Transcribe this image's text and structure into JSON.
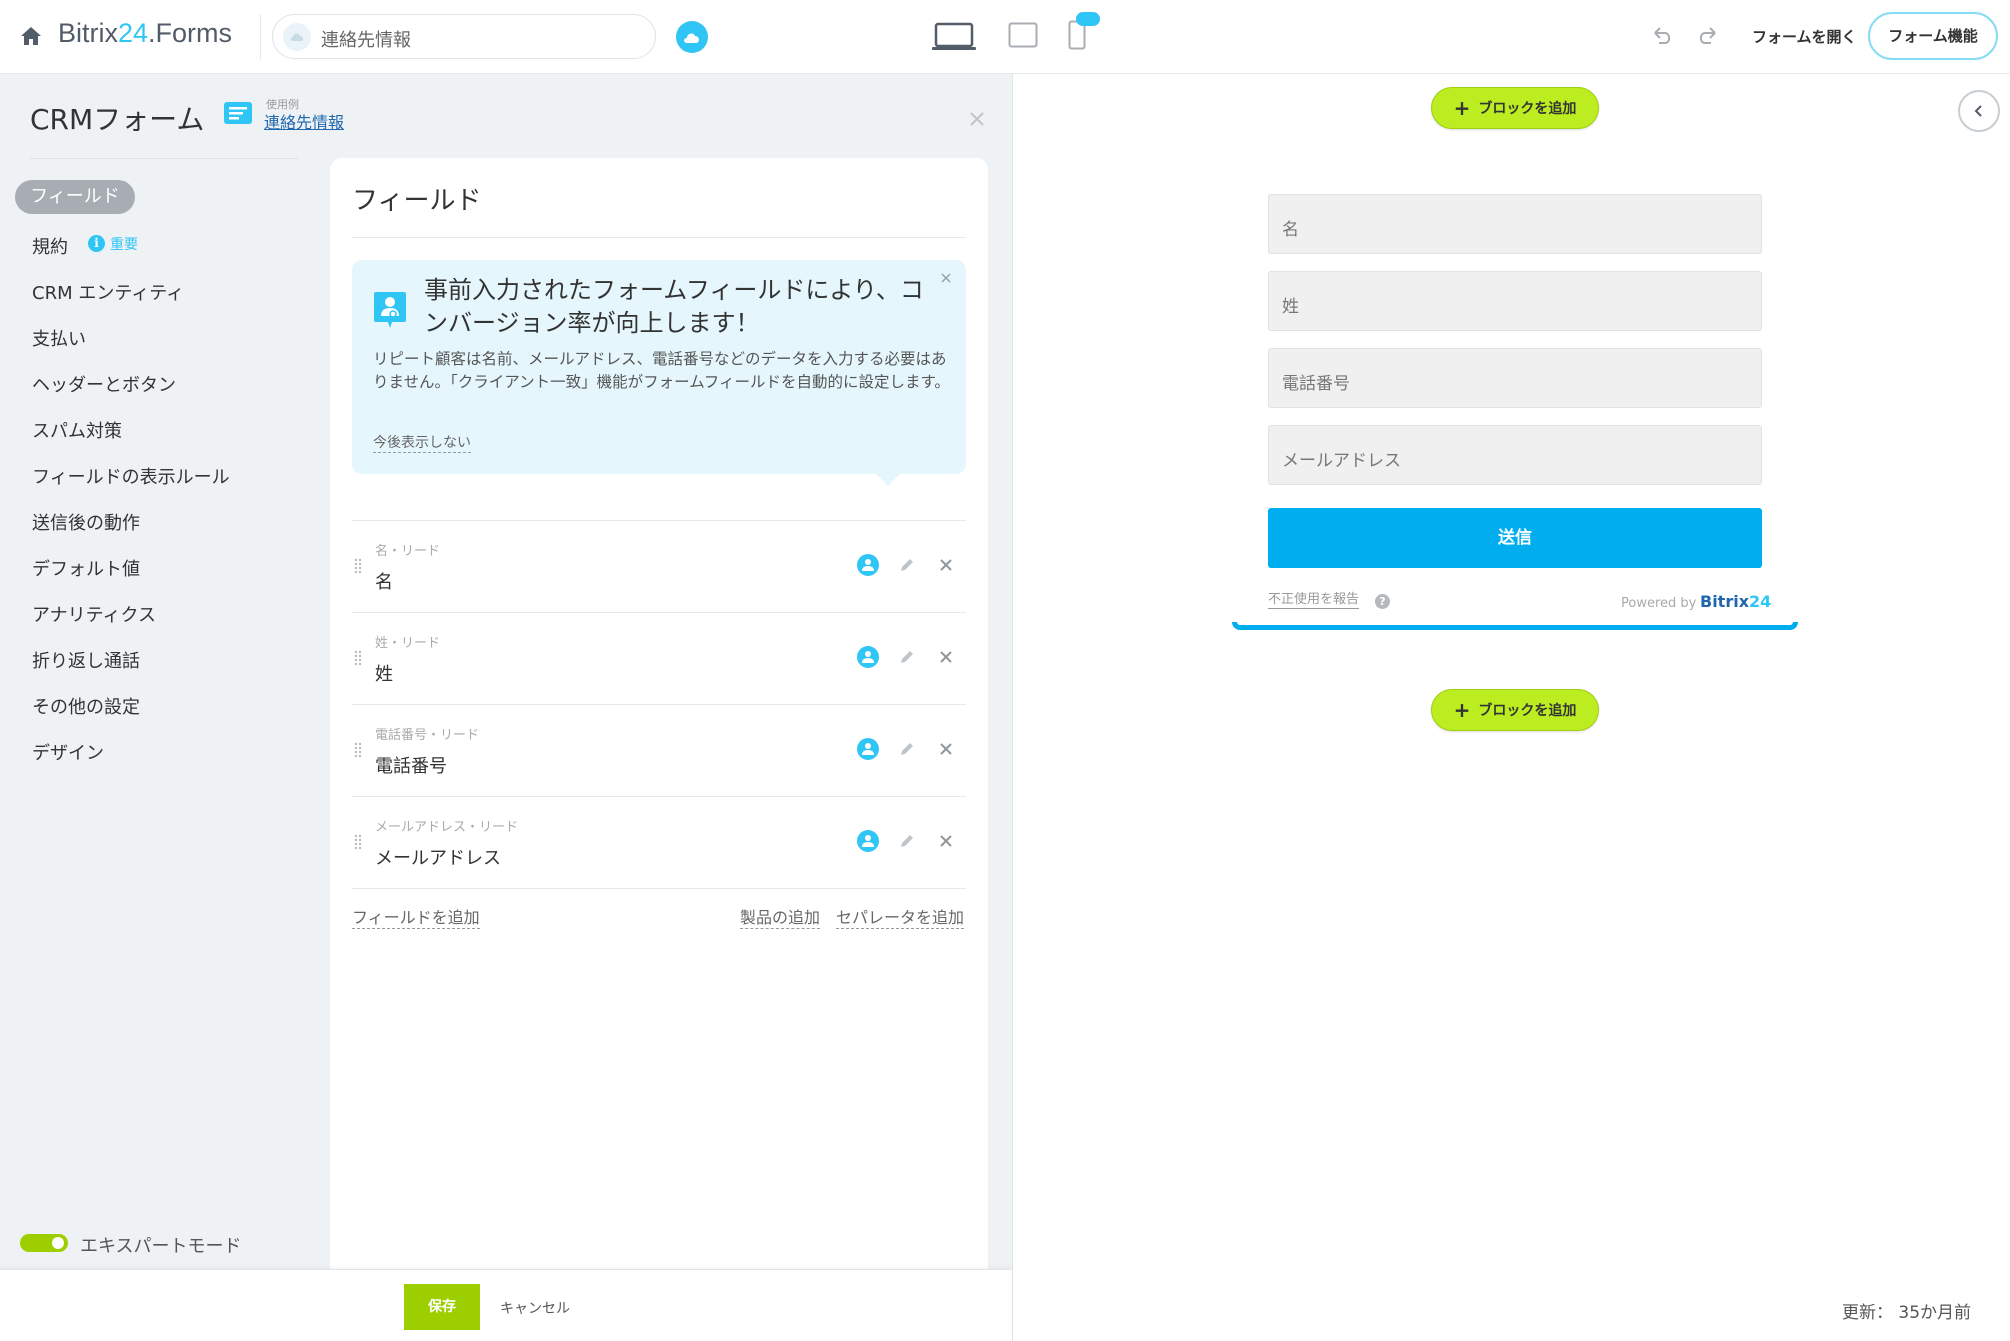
{
  "header": {
    "brand_prefix": "Bitrix",
    "brand_num": "24",
    "brand_suffix": ".Forms",
    "search_value": "連絡先情報",
    "open_form_label": "フォームを開く",
    "features_label": "フォーム機能"
  },
  "panel": {
    "title": "CRMフォーム",
    "sample_label": "使用例",
    "sample_link": "連絡先情報"
  },
  "nav": {
    "active": "フィールド",
    "items": [
      "規約",
      "CRM エンティティ",
      "支払い",
      "ヘッダーとボタン",
      "スパム対策",
      "フィールドの表示ルール",
      "送信後の動作",
      "デフォルト値",
      "アナリティクス",
      "折り返し通話",
      "その他の設定",
      "デザイン"
    ],
    "important_badge": "重要",
    "expert_mode": "エキスパートモード"
  },
  "fields_card": {
    "title": "フィールド",
    "info_title": "事前入力されたフォームフィールドにより、コンバージョン率が向上します！",
    "info_text": "リピート顧客は名前、メールアドレス、電話番号などのデータを入力する必要はありません。「クライアント一致」機能がフォームフィールドを自動的に設定します。",
    "info_dismiss": "今後表示しない",
    "fields": [
      {
        "sub": "名・リード",
        "name": "名"
      },
      {
        "sub": "姓・リード",
        "name": "姓"
      },
      {
        "sub": "電話番号・リード",
        "name": "電話番号"
      },
      {
        "sub": "メールアドレス・リード",
        "name": "メールアドレス"
      }
    ],
    "add_field": "フィールドを追加",
    "add_product": "製品の追加",
    "add_separator": "セパレータを追加"
  },
  "footer": {
    "save": "保存",
    "cancel": "キャンセル",
    "updated": "更新：  35か月前"
  },
  "preview": {
    "add_block": "ブロックを追加",
    "inputs": [
      "名",
      "姓",
      "電話番号",
      "メールアドレス"
    ],
    "submit": "送信",
    "report_abuse": "不正使用を報告",
    "help": "?",
    "powered_by": "Powered by",
    "logo_text": "Bitrix",
    "logo_num": "24"
  },
  "colors": {
    "accent": "#2fc6f6",
    "submit": "#00aeef",
    "add_block": "#bbed21",
    "save": "#9dcf00"
  }
}
